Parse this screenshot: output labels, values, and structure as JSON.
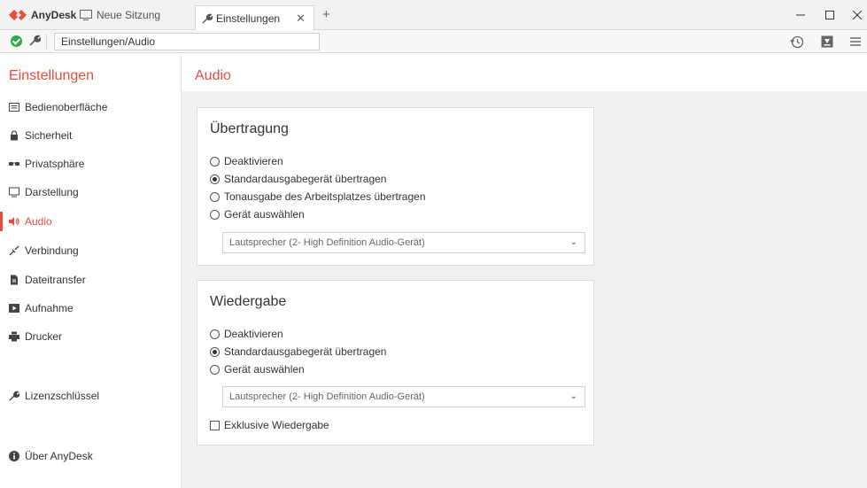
{
  "app": {
    "brand": "AnyDesk",
    "brand_color": "#e84c3d",
    "tabs": [
      {
        "label": "Neue Sitzung",
        "icon": "monitor-icon"
      },
      {
        "label": "Einstellungen",
        "icon": "wrench-icon"
      }
    ]
  },
  "addressbar": {
    "value": "Einstellungen/Audio"
  },
  "sidebar": {
    "title": "Einstellungen",
    "items": [
      {
        "label": "Bedienoberfläche",
        "icon": "user-interface-icon"
      },
      {
        "label": "Sicherheit",
        "icon": "lock-icon"
      },
      {
        "label": "Privatsphäre",
        "icon": "privacy-glasses-icon"
      },
      {
        "label": "Darstellung",
        "icon": "monitor-icon"
      },
      {
        "label": "Audio",
        "icon": "speaker-icon"
      },
      {
        "label": "Verbindung",
        "icon": "connection-icon"
      },
      {
        "label": "Dateitransfer",
        "icon": "file-icon"
      },
      {
        "label": "Aufnahme",
        "icon": "recording-icon"
      },
      {
        "label": "Drucker",
        "icon": "printer-icon"
      },
      {
        "label": "Lizenzschlüssel",
        "icon": "key-icon"
      },
      {
        "label": "Über AnyDesk",
        "icon": "info-icon"
      }
    ]
  },
  "main": {
    "title": "Audio",
    "transmission": {
      "title": "Übertragung",
      "options": [
        "Deaktivieren",
        "Standardausgabegerät übertragen",
        "Tonausgabe des Arbeitsplatzes übertragen",
        "Gerät auswählen"
      ],
      "selected_index": 1,
      "device": "Lautsprecher (2- High Definition Audio-Gerät)"
    },
    "playback": {
      "title": "Wiedergabe",
      "options": [
        "Deaktivieren",
        "Standardausgabegerät übertragen",
        "Gerät auswählen"
      ],
      "selected_index": 1,
      "device": "Lautsprecher (2- High Definition Audio-Gerät)",
      "exclusive_label": "Exklusive Wiedergabe",
      "exclusive_checked": false
    }
  }
}
